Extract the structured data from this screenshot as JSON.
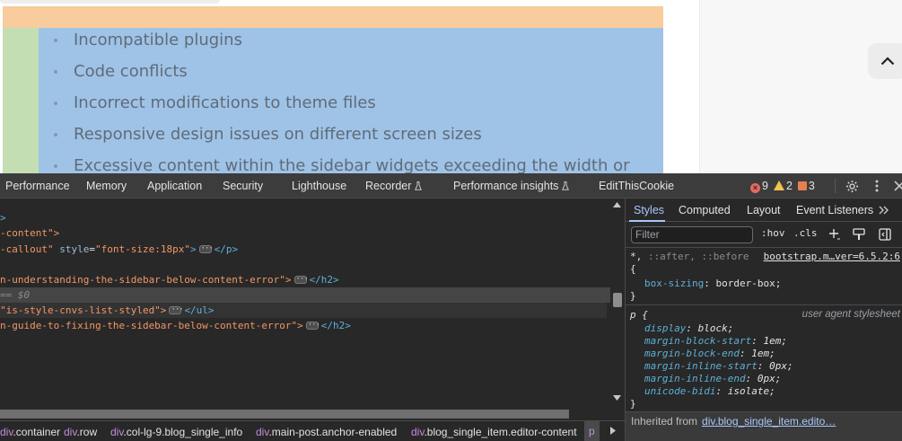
{
  "page": {
    "list_items": [
      "Incompatible plugins",
      "Code conflicts",
      "Incorrect modifications to theme files",
      "Responsive design issues on different screen sizes",
      "Excessive content within the sidebar widgets exceeding the width or"
    ],
    "scroll_top_icon": "chevron-up-icon",
    "colors": {
      "margin_overlay": "#f8cc9c",
      "padding_overlay": "#c3deb3",
      "content_overlay": "#9fc3e7"
    }
  },
  "devtools": {
    "tabs": [
      "Performance",
      "Memory",
      "Application",
      "Security",
      "Lighthouse",
      "Recorder",
      "Performance insights",
      "EditThisCookie"
    ],
    "experimental_icon": "flask-icon",
    "counts": {
      "errors": "9",
      "warnings": "2",
      "issues": "3"
    },
    "elements": {
      "lines": {
        "l0_end": ">",
        "l1_attr": "-content\">",
        "l2_attr": "-callout\"",
        "l2_style_name": "style",
        "l2_style_val": "\"font-size:18px\"",
        "l2_close": "</p>",
        "l3_attr": "n-understanding-the-sidebar-below-content-error\">",
        "l3_close": "</h2>",
        "l4_text": "== $0",
        "l5_attr": "\"is-style-cnvs-list-styled\">",
        "l5_close": "</ul>",
        "l6_attr": "n-guide-to-fixing-the-sidebar-below-content-error\">",
        "l6_close": "</h2>"
      }
    },
    "breadcrumbs": [
      {
        "tag": "div",
        "cls": ".container"
      },
      {
        "tag": "div",
        "cls": ".row"
      },
      {
        "tag": "div",
        "cls": ".col-lg-9.blog_single_info"
      },
      {
        "tag": "div",
        "cls": ".main-post.anchor-enabled"
      },
      {
        "tag": "div",
        "cls": ".blog_single_item.editor-content"
      },
      {
        "tag": "p",
        "cls": ""
      }
    ],
    "styles": {
      "subtabs": [
        "Styles",
        "Computed",
        "Layout",
        "Event Listeners"
      ],
      "filter_placeholder": "Filter",
      "hov": ":hov",
      "cls": ".cls",
      "rule1": {
        "selector": "*,",
        "selector_gray": "::after, ::before",
        "source": "bootstrap.m…ver=6.5.2:6",
        "prop": "box-sizing",
        "value": "border-box;"
      },
      "rule2": {
        "selector": "p {",
        "source": "user agent stylesheet",
        "decls": [
          {
            "prop": "display",
            "value": "block;"
          },
          {
            "prop": "margin-block-start",
            "value": "1em;"
          },
          {
            "prop": "margin-block-end",
            "value": "1em;"
          },
          {
            "prop": "margin-inline-start",
            "value": "0px;"
          },
          {
            "prop": "margin-inline-end",
            "value": "0px;"
          },
          {
            "prop": "unicode-bidi",
            "value": "isolate;"
          }
        ]
      },
      "inherited_label": "Inherited from",
      "inherited_link": "div.blog_single_item.edito…"
    }
  }
}
